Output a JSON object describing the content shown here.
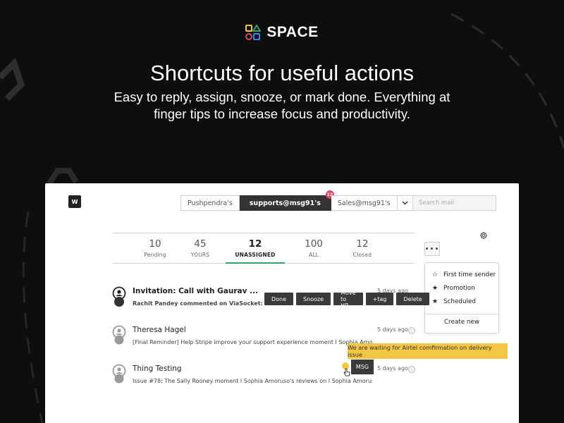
{
  "brand": {
    "name": "SPACE",
    "logo_icon": "space-logo-shapes"
  },
  "hero": {
    "headline": "Shortcuts for useful actions",
    "subline": "Easy to reply, assign, snooze, or mark done. Everything at finger tips to increase focus and productivity."
  },
  "app": {
    "workspace_badge": "W",
    "inbox_tabs": [
      {
        "label": "Pushpendra's",
        "active": false
      },
      {
        "label": "supports@msg91's",
        "active": true,
        "badge": "12"
      },
      {
        "label": "Sales@msg91's",
        "active": false
      }
    ],
    "search_placeholder": "Search mail",
    "status_tabs": [
      {
        "count": "10",
        "label": "Pending"
      },
      {
        "count": "45",
        "label": "YOURS"
      },
      {
        "count": "12",
        "label": "UNASSIGNED",
        "active": true
      },
      {
        "count": "100",
        "label": "ALL"
      },
      {
        "count": "12",
        "label": "Closed"
      }
    ],
    "more_button": "•••",
    "menu": {
      "items": [
        {
          "icon": "star-outline-icon",
          "label": "First time sender"
        },
        {
          "icon": "star-icon",
          "label": "Promotion"
        },
        {
          "icon": "star-icon",
          "label": "Scheduled"
        }
      ],
      "create": "Create new"
    },
    "messages": [
      {
        "subject": "Invitation: Call with Gaurav ...",
        "preview": "Rachit Pandey commented on ViaSocket: \"Can re",
        "time": "5 days ago",
        "unread": true
      },
      {
        "subject": "Theresa Hagel",
        "preview": "[Final Reminder] Help Stripe improve your support experience moment I Sophia Amoruso's",
        "time": "5 days ago",
        "unread": false
      },
      {
        "subject": "Thing Testing",
        "preview": "Issue #78: The Sally Rooney moment I Sophia Amoruso's reviews on  I Sophia Amoruso's re",
        "time": "5 days ago",
        "unread": false
      }
    ],
    "actions": [
      "Done",
      "Snooze",
      "Move to HR",
      "+tag",
      "Delete"
    ],
    "tooltip": "We are waiting for Airtel comfirmation on delivery issue",
    "msg_button": "MSG"
  },
  "colors": {
    "background": "#0e0e0e",
    "active_tab": "#333333",
    "underline": "#2ea36b",
    "notification": "#e2445c",
    "tooltip": "#f3c645"
  }
}
